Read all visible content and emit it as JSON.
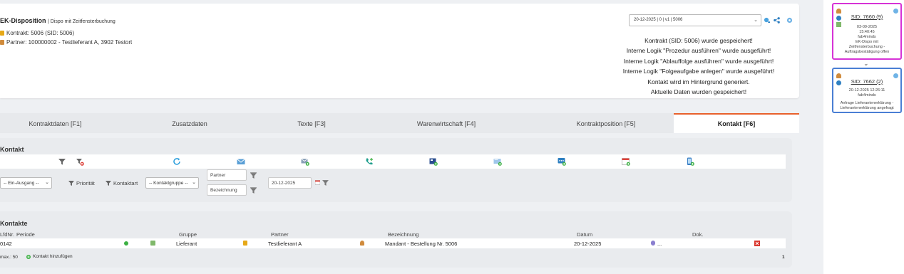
{
  "header": {
    "title": "EK-Disposition",
    "subtitle": "| Dispo mit Zeitfensterbuchung",
    "contract_line": "Kontrakt: 5006 (SID: 5006)",
    "partner_line": "Partner: 100000002 - Testlieferant A, 3902 Testort",
    "version_select": "20-12-2025 | 0 | v1 | 5006"
  },
  "messages": [
    "Kontrakt (SID: 5006) wurde gespeichert!",
    "Interne Logik \"Prozedur ausführen\" wurde ausgeführt!",
    "Interne Logik \"Ablauffolge ausführen\" wurde ausgeführt!",
    "Interne Logik \"Folgeaufgabe anlegen\" wurde ausgeführt!",
    "Kontakt wird im Hintergrund generiert.",
    "Aktuelle Daten wurden gespeichert!"
  ],
  "tabs": [
    {
      "label": "Kontraktdaten [F1]"
    },
    {
      "label": "Zusatzdaten"
    },
    {
      "label": "Texte [F3]"
    },
    {
      "label": "Warenwirtschaft [F4]"
    },
    {
      "label": "Kontraktposition [F5]"
    },
    {
      "label": "Kontakt [F6]"
    }
  ],
  "kontakt_panel": {
    "title": "Kontakt",
    "filters": {
      "direction": "-- Ein-Ausgang --",
      "prioritaet": "Priorität",
      "kontaktart": "Kontaktart",
      "kontaktgruppe": "-- Kontaktgruppe --",
      "partner_placeholder": "Partner",
      "bezeichnung_placeholder": "Bezeichnung",
      "date": "20-12-2025"
    }
  },
  "kontakte_panel": {
    "title": "Kontakte",
    "headers": {
      "lfdnr": "LfdNr.",
      "periode": "Periode",
      "gruppe": "Gruppe",
      "partner": "Partner",
      "bezeichnung": "Bezeichnung",
      "datum": "Datum",
      "dok": "Dok."
    },
    "rows": [
      {
        "lfdnr": "0142",
        "gruppe": "Lieferant",
        "partner": "Testlieferant A",
        "bezeichnung": "Mandant - Bestellung Nr. 5006",
        "datum": "20-12-2025",
        "dok": "..."
      }
    ],
    "max_label": "max.: 50",
    "add_label": "Kontakt hinzufügen",
    "page": "1"
  },
  "sid_cards": [
    {
      "sid": "SID: 7660 (9)",
      "date": "03-09-2025",
      "time": "15:40:45",
      "user": "fab4minds",
      "desc1": "EK-Dispo mit",
      "desc2": "Zeitfensterbuchung -",
      "desc3": "Auftragsbestätigung offen",
      "border_color": "#d633d6"
    },
    {
      "sid": "SID: 7662 (2)",
      "datetime": "20-12-2025 12:26:11",
      "user": "fab4minds",
      "desc1": "Anfrage Lieferantenerklärung -",
      "desc2": "Lieferantenerklärung angefragt",
      "border_color": "#4a7fd4"
    }
  ],
  "colors": {
    "accent_tab": "#e8602c",
    "status_green": "#3cb043",
    "delete_red": "#d9342b",
    "icon_blue": "#2d7fc1"
  }
}
